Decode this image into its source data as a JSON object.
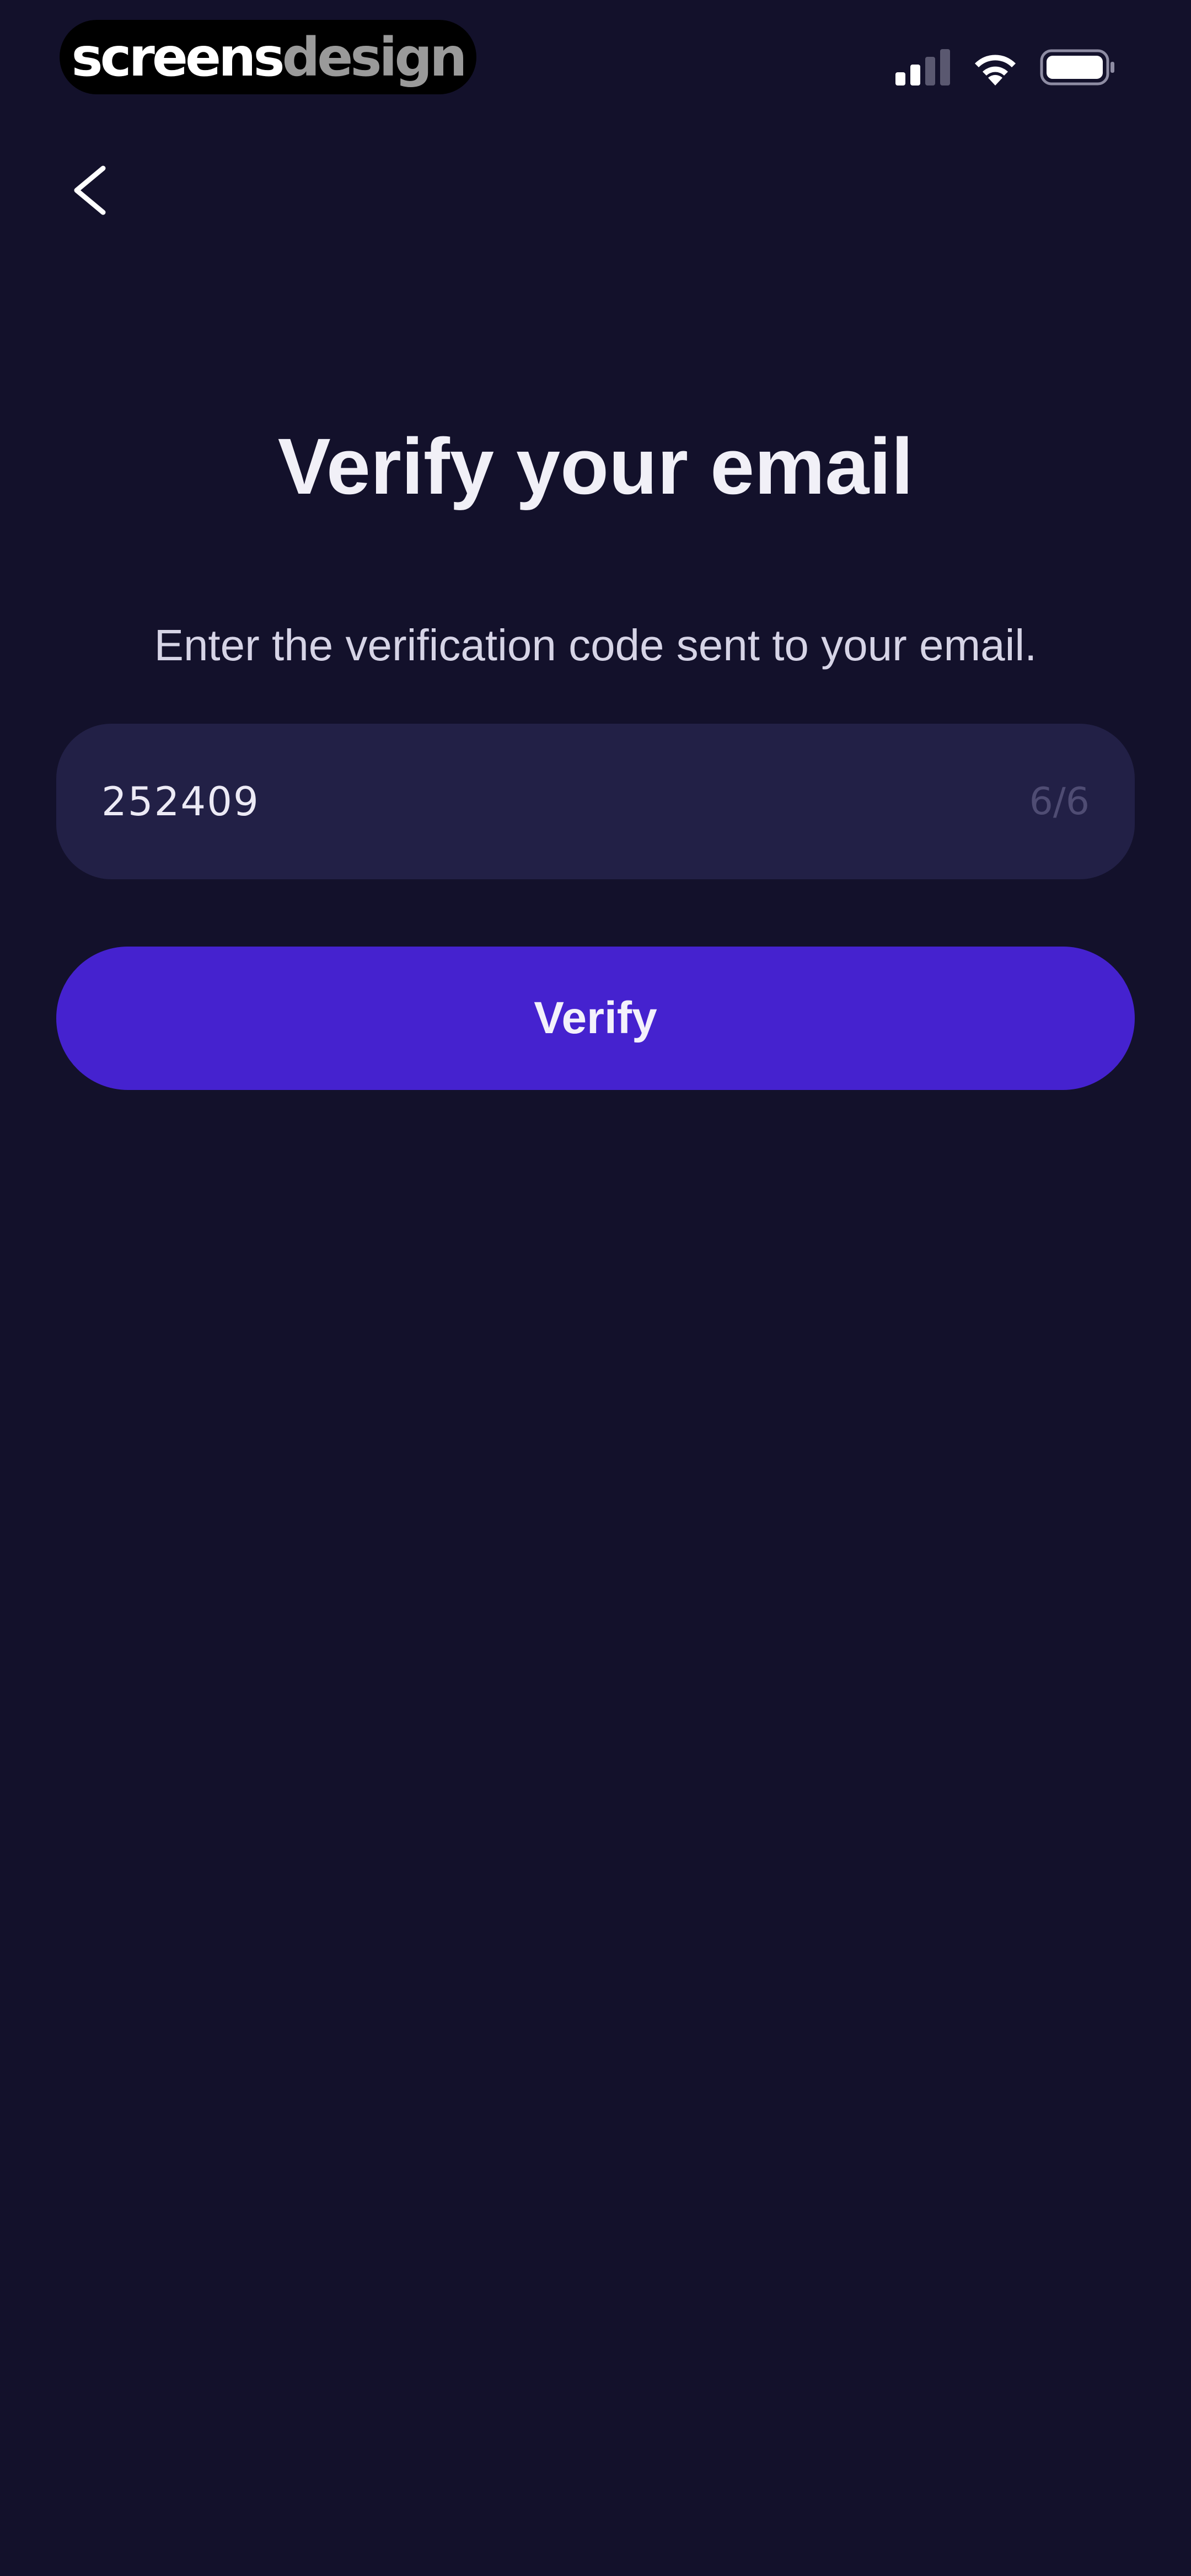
{
  "status_bar": {
    "watermark_primary": "screens",
    "watermark_secondary": "design",
    "icons": [
      "cellular-signal-icon",
      "wifi-icon",
      "battery-icon"
    ]
  },
  "nav": {
    "back_icon": "chevron-left-icon"
  },
  "main": {
    "title": "Verify your email",
    "subtitle": "Enter the verification code sent to your email.",
    "code_input": {
      "value": "252409",
      "counter": "6/6"
    },
    "verify_button_label": "Verify"
  },
  "colors": {
    "background": "#13112b",
    "input_background": "#222046",
    "accent": "#4522cf",
    "text_primary": "#f1f0f7",
    "text_muted": "#4f4c73"
  }
}
